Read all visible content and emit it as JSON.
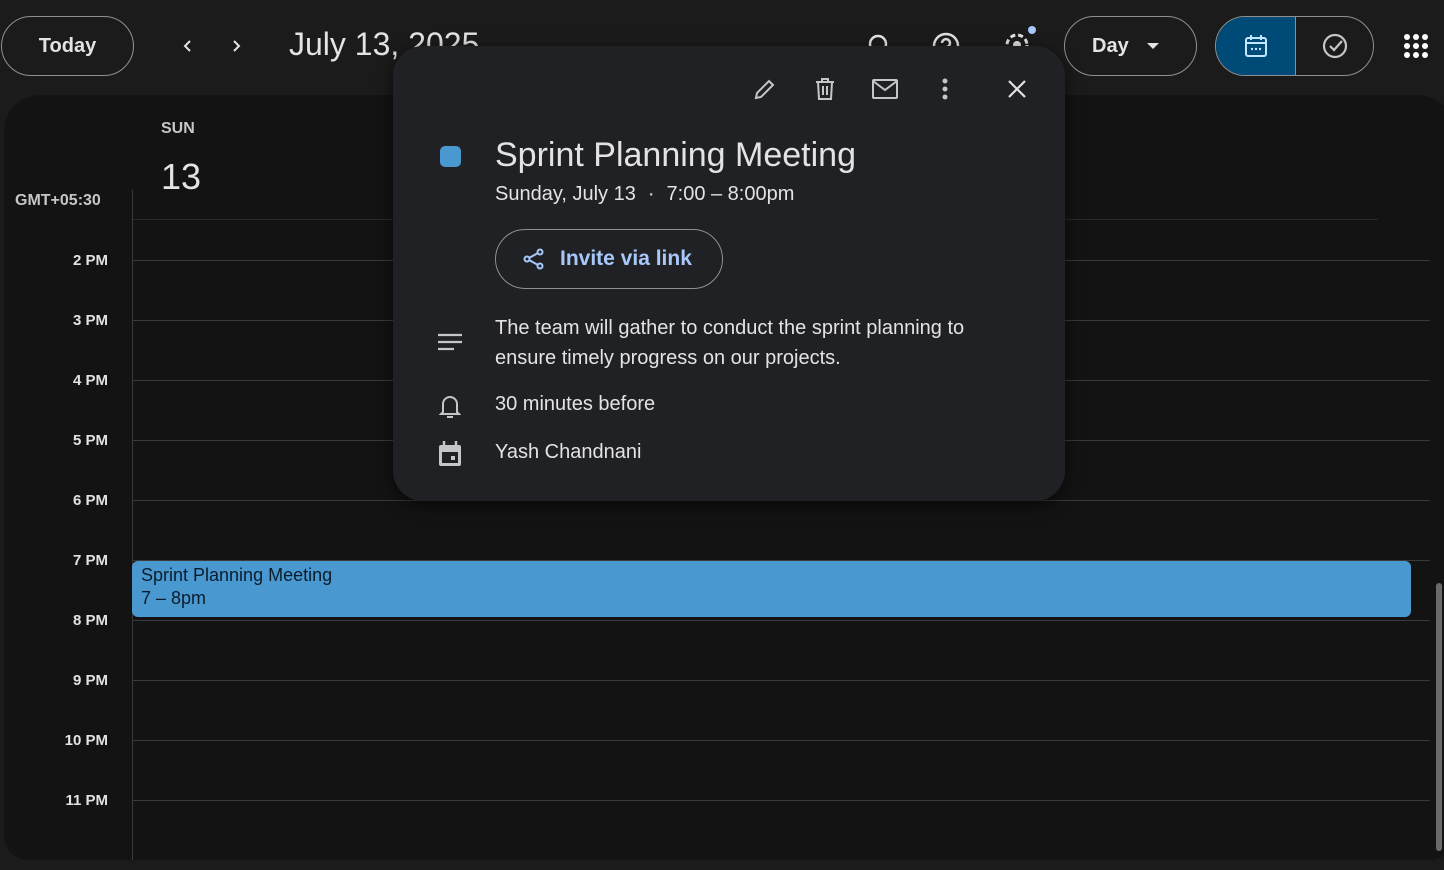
{
  "header": {
    "today_label": "Today",
    "date_title": "July 13, 2025",
    "view_label": "Day",
    "accent": "#004a77"
  },
  "day": {
    "weekday": "SUN",
    "date": "13",
    "timezone": "GMT+05:30"
  },
  "hours": [
    "2 PM",
    "3 PM",
    "4 PM",
    "5 PM",
    "6 PM",
    "7 PM",
    "8 PM",
    "9 PM",
    "10 PM",
    "11 PM"
  ],
  "event": {
    "title": "Sprint Planning Meeting",
    "time": "7 – 8pm",
    "color": "#4a98d0"
  },
  "popup": {
    "title": "Sprint Planning Meeting",
    "date": "Sunday, July 13",
    "separator": "·",
    "time": "7:00 – 8:00pm",
    "invite_label": "Invite via link",
    "description": "The team will gather to conduct the sprint planning to ensure timely progress on our projects.",
    "reminder": "30 minutes before",
    "calendar": "Yash Chandnani"
  }
}
